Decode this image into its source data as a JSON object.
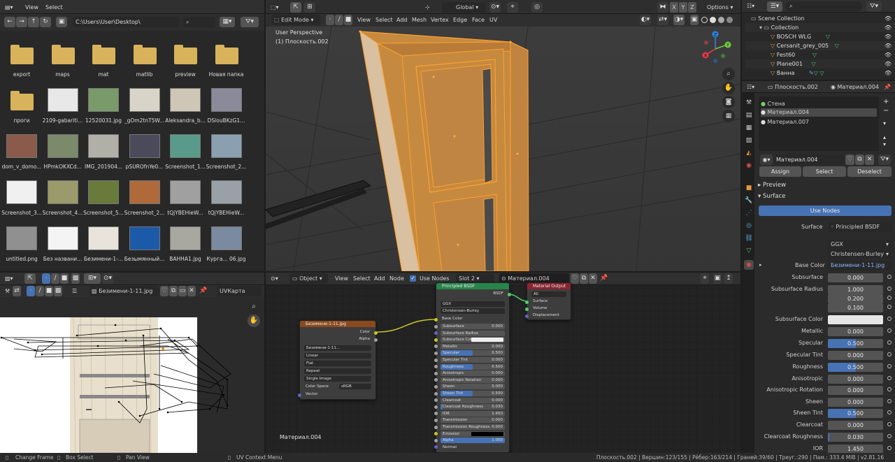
{
  "file_browser": {
    "menu": [
      "View",
      "Select"
    ],
    "path": "C:\\Users\\User\\Desktop\\",
    "items": [
      {
        "label": "export",
        "kind": "folder"
      },
      {
        "label": "maps",
        "kind": "folder"
      },
      {
        "label": "mat",
        "kind": "folder"
      },
      {
        "label": "matlib",
        "kind": "folder"
      },
      {
        "label": "preview",
        "kind": "folder"
      },
      {
        "label": "Новая папка",
        "kind": "folder"
      },
      {
        "label": "проги",
        "kind": "folder"
      },
      {
        "label": "2109-gabariti...",
        "kind": "image",
        "color": "#e8e8e8"
      },
      {
        "label": "12520031.jpg",
        "kind": "image",
        "color": "#7a9a6a"
      },
      {
        "label": "_gOm2tnT5W...",
        "kind": "image",
        "color": "#d8d4c8"
      },
      {
        "label": "Aleksandra_b...",
        "kind": "image",
        "color": "#cfc7b5"
      },
      {
        "label": "DSlouBKzG1...",
        "kind": "image",
        "color": "#8a8a9a"
      },
      {
        "label": "dom_v_domo...",
        "kind": "image",
        "color": "#8a5a4a"
      },
      {
        "label": "HPmkOKXCd...",
        "kind": "image",
        "color": "#7a8a6a"
      },
      {
        "label": "IMG_201904...",
        "kind": "image",
        "color": "#b0b0a8"
      },
      {
        "label": "pSUROfnYe0...",
        "kind": "image",
        "color": "#4a4a5a"
      },
      {
        "label": "Screenshot_1...",
        "kind": "image",
        "color": "#5a9a8a"
      },
      {
        "label": "Screenshot_2...",
        "kind": "image",
        "color": "#8aa0b0"
      },
      {
        "label": "Screenshot_3...",
        "kind": "image",
        "color": "#f0f0f0"
      },
      {
        "label": "Screenshot_4...",
        "kind": "image",
        "color": "#9a9a6a"
      },
      {
        "label": "Screenshot_5...",
        "kind": "image",
        "color": "#6a7a3a"
      },
      {
        "label": "Screenshot_2...",
        "kind": "image",
        "color": "#b06a3a"
      },
      {
        "label": "tQjYBEHieW...",
        "kind": "image",
        "color": "#a0a0a0"
      },
      {
        "label": "tQjYBEHieW...",
        "kind": "image",
        "color": "#9aa0a8"
      },
      {
        "label": "untitled.png",
        "kind": "image",
        "color": "#909090"
      },
      {
        "label": "Без названи...",
        "kind": "image",
        "color": "#f4f4f4"
      },
      {
        "label": "Безимени-1-...",
        "kind": "image",
        "color": "#e8e4dc"
      },
      {
        "label": "Безымянный...",
        "kind": "image",
        "color": "#1a5aa8"
      },
      {
        "label": "ВАННА1.jpg",
        "kind": "image",
        "color": "#a8a8a0"
      },
      {
        "label": "Курга... 06.jpg",
        "kind": "image",
        "color": "#7a8aa0"
      }
    ]
  },
  "viewport": {
    "mode": "Edit Mode",
    "menu": [
      "View",
      "Select",
      "Add",
      "Mesh",
      "Vertex",
      "Edge",
      "Face",
      "UV"
    ],
    "orientation": "Global",
    "options": "Options",
    "axes": [
      "X",
      "Y",
      "Z"
    ],
    "overlay_title": "User Perspective",
    "overlay_object": "(1) Плоскость.002",
    "gizmo": [
      "Z",
      "Y",
      "X"
    ]
  },
  "outliner": {
    "search": "",
    "rows": [
      {
        "label": "Scene Collection"
      },
      {
        "label": "Collection"
      },
      {
        "label": "BOSCH WLG"
      },
      {
        "label": "Cersanit_grey_005"
      },
      {
        "label": "Fest60"
      },
      {
        "label": "Plane001"
      },
      {
        "label": "Ванна"
      }
    ]
  },
  "properties": {
    "object": "Плоскость.002",
    "material": "Материал.004",
    "slots": [
      "Стена",
      "Материал.004",
      "Материал.007"
    ],
    "mat_field": "Материал.004",
    "assign": "Assign",
    "select": "Select",
    "deselect": "Deselect",
    "preview": "Preview",
    "surface": "Surface",
    "use_nodes": "Use Nodes",
    "surface_label": "Surface",
    "surface_value": "Principled BSDF",
    "dist": "GGX",
    "sss_method": "Christensen-Burley",
    "base_color_label": "Base Color",
    "base_color_value": "Безимени-1-11.jpg",
    "fields": [
      {
        "label": "Subsurface",
        "value": "0.000",
        "fill": 0
      },
      {
        "label": "Subsurface Radius",
        "value": "1.000",
        "fill": 0
      },
      {
        "label": "",
        "value": "0.200",
        "fill": 0
      },
      {
        "label": "",
        "value": "0.100",
        "fill": 0
      },
      {
        "label": "Subsurface Color",
        "value": "",
        "fill": 0,
        "swatch": "#e6e6e6"
      },
      {
        "label": "Metallic",
        "value": "0.000",
        "fill": 0
      },
      {
        "label": "Specular",
        "value": "0.500",
        "fill": 0.5
      },
      {
        "label": "Specular Tint",
        "value": "0.000",
        "fill": 0
      },
      {
        "label": "Roughness",
        "value": "0.500",
        "fill": 0.5
      },
      {
        "label": "Anisotropic",
        "value": "0.000",
        "fill": 0
      },
      {
        "label": "Anisotropic Rotation",
        "value": "0.000",
        "fill": 0
      },
      {
        "label": "Sheen",
        "value": "0.000",
        "fill": 0
      },
      {
        "label": "Sheen Tint",
        "value": "0.500",
        "fill": 0.5
      },
      {
        "label": "Clearcoat",
        "value": "0.000",
        "fill": 0
      },
      {
        "label": "Clearcoat Roughness",
        "value": "0.030",
        "fill": 0.03
      },
      {
        "label": "IOR",
        "value": "1.450",
        "fill": 0
      }
    ]
  },
  "uv_editor": {
    "image": "Безимени-1-11.jpg",
    "uvmap": "UVКарта"
  },
  "node_editor": {
    "type": "Object",
    "menu": [
      "View",
      "Select",
      "Add",
      "Node"
    ],
    "use_nodes": "Use Nodes",
    "slot": "Slot 2",
    "material": "Материал.004",
    "footer_label": "Материал.004",
    "image_node": {
      "title": "Безимени-1-11.jpg",
      "out_color": "Color",
      "out_alpha": "Alpha",
      "image": "Безимени-1-11...",
      "interp": "Linear",
      "proj": "Flat",
      "ext": "Repeat",
      "source": "Single Image",
      "cs_label": "Color Space",
      "cs_value": "sRGB",
      "vector": "Vector"
    },
    "bsdf_node": {
      "title": "Principled BSDF",
      "out": "BSDF",
      "dist": "GGX",
      "sss": "Christensen-Burley",
      "base_color": "Base Color",
      "rows": [
        {
          "label": "Subsurface",
          "value": "0.000",
          "fill": 0
        },
        {
          "label": "Subsurface Radius",
          "value": "",
          "fill": 0
        },
        {
          "label": "Subsurface Color",
          "value": "",
          "fill": 0,
          "swatch": true
        },
        {
          "label": "Metallic",
          "value": "0.000",
          "fill": 0
        },
        {
          "label": "Specular",
          "value": "0.500",
          "fill": 0.5
        },
        {
          "label": "Specular Tint",
          "value": "0.000",
          "fill": 0
        },
        {
          "label": "Roughness",
          "value": "0.500",
          "fill": 0.5
        },
        {
          "label": "Anisotropic",
          "value": "0.000",
          "fill": 0
        },
        {
          "label": "Anisotropic Rotation",
          "value": "0.000",
          "fill": 0
        },
        {
          "label": "Sheen",
          "value": "0.000",
          "fill": 0
        },
        {
          "label": "Sheen Tint",
          "value": "0.500",
          "fill": 0.5
        },
        {
          "label": "Clearcoat",
          "value": "0.000",
          "fill": 0
        },
        {
          "label": "Clearcoat Roughness",
          "value": "0.030",
          "fill": 0.03
        },
        {
          "label": "IOR",
          "value": "1.450",
          "fill": 0
        },
        {
          "label": "Transmission",
          "value": "0.000",
          "fill": 0
        },
        {
          "label": "Transmission Roughness",
          "value": "0.000",
          "fill": 0
        },
        {
          "label": "Emission",
          "value": "",
          "fill": 0,
          "black": true
        },
        {
          "label": "Alpha",
          "value": "1.000",
          "fill": 1
        },
        {
          "label": "Normal",
          "value": "",
          "fill": 0,
          "plain": true
        }
      ]
    },
    "output_node": {
      "title": "Material Output",
      "target": "All",
      "inputs": [
        "Surface",
        "Volume",
        "Displacement"
      ]
    }
  },
  "status": {
    "left": [
      "Change Frame",
      "Box Select",
      "Pan View",
      "UV Context Menu"
    ],
    "right": "Плоскость.002 | Вершин:123/155 | Рёбер:163/214 | Граней:39/60 | Треуг.:290 | Пам.: 333.4 MiB | v2.81.16"
  }
}
